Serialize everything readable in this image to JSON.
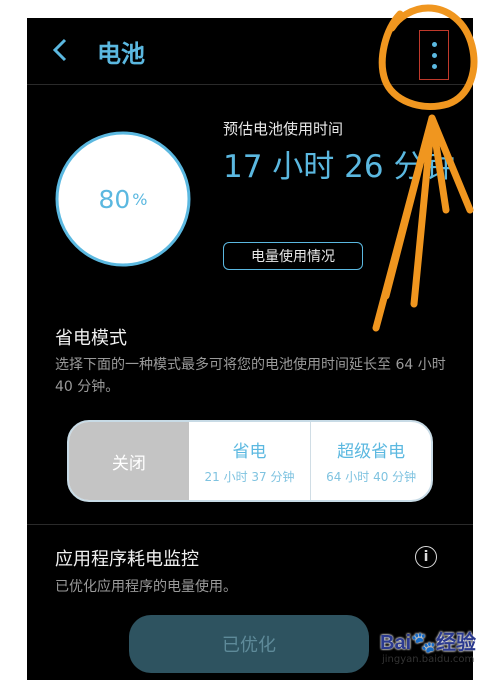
{
  "header": {
    "title": "电池",
    "back_icon": "back-arrow-icon",
    "menu_icon": "more-vertical-icon"
  },
  "battery": {
    "percent_value": "80",
    "percent_sign": "%",
    "level": 0.8
  },
  "estimate": {
    "label": "预估电池使用时间",
    "time": "17 小时 26 分钟"
  },
  "usage_button": {
    "label": "电量使用情况"
  },
  "power_saving": {
    "title": "省电模式",
    "description": "选择下面的一种模式最多可将您的电池使用时间延长至 64 小时 40 分钟。",
    "modes": [
      {
        "name": "关闭",
        "sub": ""
      },
      {
        "name": "省电",
        "sub": "21 小时 37 分钟"
      },
      {
        "name": "超级省电",
        "sub": "64 小时 40 分钟"
      }
    ]
  },
  "app_monitor": {
    "title": "应用程序耗电监控",
    "description": "已优化应用程序的电量使用。",
    "button": "已优化",
    "info_icon": "info-icon"
  },
  "watermark": {
    "logo_text": "Bai",
    "logo_paw": "🐾",
    "logo_suffix": "经验",
    "url": "jingyan.baidu.com"
  },
  "colors": {
    "accent": "#5bb8e0",
    "background": "#000000",
    "annotation": "#f0961f"
  }
}
